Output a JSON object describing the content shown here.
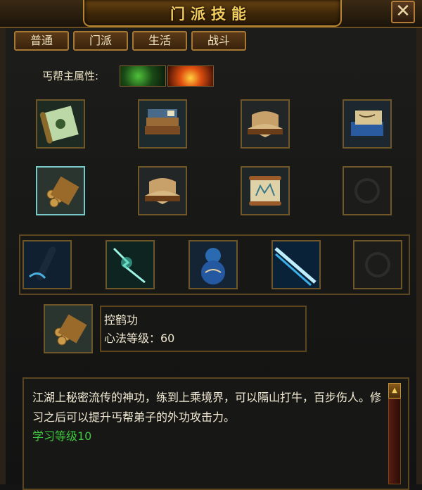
{
  "window": {
    "title": "门派技能",
    "close_glyph": "✕"
  },
  "tabs": [
    "普通",
    "门派",
    "生活",
    "战斗"
  ],
  "faction": {
    "attr_label": "丐帮主属性:",
    "attr_icons": [
      "poison-icon",
      "fire-icon"
    ]
  },
  "skill_grid": [
    [
      "scroll-icon",
      "book-stack-icon",
      "open-book-icon",
      "blue-books-icon"
    ],
    [
      "bamboo-bundle-icon",
      "open-book-icon",
      "martial-scroll-icon",
      "empty-slot"
    ]
  ],
  "active_skills": [
    "staff-icon",
    "lightning-icon",
    "gourd-icon",
    "light-beam-icon",
    "empty-slot"
  ],
  "selected": {
    "icon": "bamboo-bundle-icon",
    "name": "控鹤功",
    "level_text": "心法等级：60"
  },
  "description": {
    "text": "江湖上秘密流传的神功，练到上乘境界，可以隔山打牛，百步伤人。修习之后可以提升丐帮弟子的外功攻击力。",
    "learn_level": "学习等级10"
  },
  "colors": {
    "gold": "#f3cd5e",
    "green": "#3ec83e",
    "frame": "#6e5628"
  }
}
